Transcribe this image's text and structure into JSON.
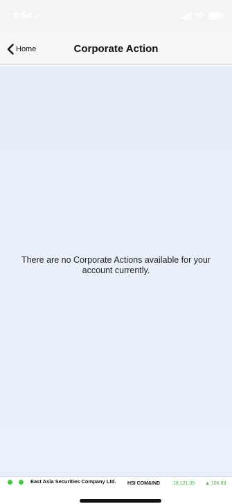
{
  "status_bar": {
    "time": "9:54",
    "location_glyph": "↗",
    "icons": [
      "signal-icon",
      "wifi-icon",
      "battery-icon"
    ]
  },
  "nav": {
    "back_label": "Home",
    "title": "Corporate Action"
  },
  "content": {
    "empty_message": "There are no Corporate Actions available for your account currently."
  },
  "ticker": {
    "company": "East Asia Securities Company Ltd.",
    "index_name": "HSI COM&IND",
    "index_value": "18,121.05",
    "index_change": "▲ 106.83",
    "indicator_color": "#3ecf3e",
    "value_color": "#4ea64e"
  },
  "colors": {
    "content_background": "#e8eef8",
    "nav_background": "#f7f7f9"
  }
}
